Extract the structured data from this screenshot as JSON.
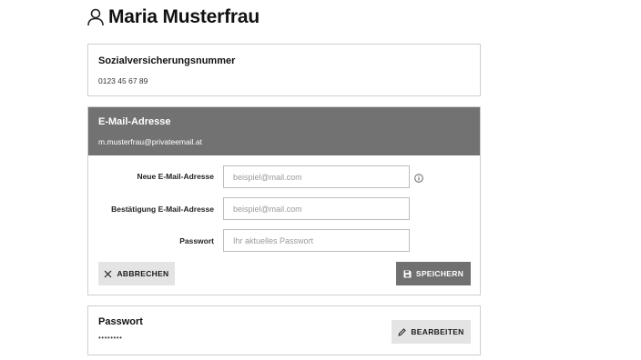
{
  "header": {
    "title": "Maria Musterfrau",
    "icon": "user-icon"
  },
  "ssn_card": {
    "label": "Sozialversicherungsnummer",
    "value": "0123 45 67 89"
  },
  "email_card": {
    "label": "E-Mail-Adresse",
    "value": "m.musterfrau@privateemail.at",
    "header_color": "#727272",
    "fields": {
      "new_email": {
        "label": "Neue E-Mail-Adresse",
        "placeholder": "beispiel@mail.com",
        "value": ""
      },
      "confirm_email": {
        "label": "Bestätigung E-Mail-Adresse",
        "placeholder": "beispiel@mail.com",
        "value": ""
      },
      "password": {
        "label": "Passwort",
        "placeholder": "Ihr aktuelles Passwort",
        "value": ""
      }
    },
    "info_icon": "info-icon",
    "cancel_button": {
      "label": "ABBRECHEN",
      "icon": "close-icon"
    },
    "save_button": {
      "label": "SPEICHERN",
      "icon": "save-icon",
      "color": "#707070"
    }
  },
  "password_card": {
    "label": "Passwort",
    "masked_value": "••••••••",
    "edit_button": {
      "label": "BEARBEITEN",
      "icon": "pencil-icon"
    }
  }
}
